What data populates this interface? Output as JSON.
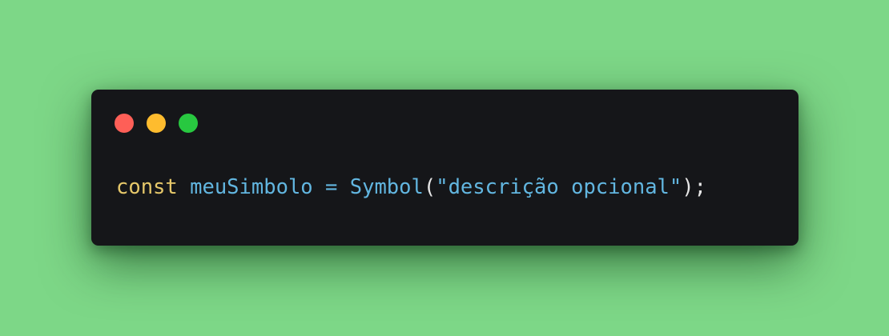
{
  "window": {
    "controls": [
      {
        "name": "close",
        "color": "#fe5f57"
      },
      {
        "name": "minimize",
        "color": "#febc2e"
      },
      {
        "name": "zoom",
        "color": "#28c840"
      }
    ]
  },
  "code": {
    "keyword": "const",
    "variable": "meuSimbolo",
    "operator": "=",
    "function": "Symbol",
    "paren_open": "(",
    "string": "\"descrição opcional\"",
    "paren_close_semicolon": ");"
  },
  "colors": {
    "background": "#7dd787",
    "window": "#151619",
    "keyword": "#e6c86a",
    "variable": "#62b6e0",
    "function": "#62b6e0",
    "string": "#62b6e0",
    "punctuation": "#e6e6e6"
  }
}
